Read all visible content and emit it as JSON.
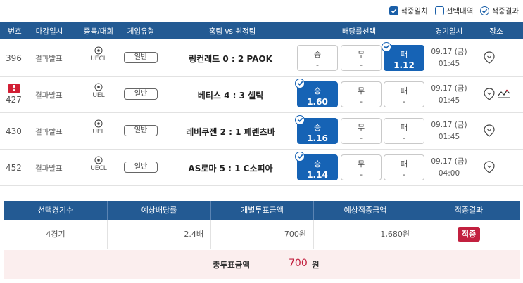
{
  "filters": [
    {
      "label": "적중일치",
      "checked": true
    },
    {
      "label": "선택내역",
      "checked": false
    },
    {
      "label": "적중결과",
      "checked": true
    }
  ],
  "columns": [
    "번호",
    "마감일시",
    "종목/대회",
    "게임유형",
    "홈팀 vs 원정팀",
    "배당률선택",
    "경기일시",
    "장소"
  ],
  "rows": [
    {
      "num": "396",
      "deadline": "결과발표",
      "league": "UECL",
      "type": "일반",
      "match": "링컨레드 0 : 2 PAOK",
      "odds": [
        {
          "label": "승",
          "value": "-"
        },
        {
          "label": "무",
          "value": "-"
        },
        {
          "label": "패",
          "value": "1.12"
        }
      ],
      "date": "09.17 (금)",
      "time": "01:45"
    },
    {
      "num": "427",
      "deadline": "결과발표",
      "league": "UEL",
      "type": "일반",
      "match": "베티스 4 : 3 셀틱",
      "odds": [
        {
          "label": "승",
          "value": "1.60"
        },
        {
          "label": "무",
          "value": "-"
        },
        {
          "label": "패",
          "value": "-"
        }
      ],
      "date": "09.17 (금)",
      "time": "01:45",
      "alert": "!"
    },
    {
      "num": "430",
      "deadline": "결과발표",
      "league": "UEL",
      "type": "일반",
      "match": "레버쿠젠 2 : 1 페렌츠바",
      "odds": [
        {
          "label": "승",
          "value": "1.16"
        },
        {
          "label": "무",
          "value": "-"
        },
        {
          "label": "패",
          "value": "-"
        }
      ],
      "date": "09.17 (금)",
      "time": "01:45"
    },
    {
      "num": "452",
      "deadline": "결과발표",
      "league": "UECL",
      "type": "일반",
      "match": "AS로마 5 : 1 C소피아",
      "odds": [
        {
          "label": "승",
          "value": "1.14"
        },
        {
          "label": "무",
          "value": "-"
        },
        {
          "label": "패",
          "value": "-"
        }
      ],
      "date": "09.17 (금)",
      "time": "04:00"
    }
  ],
  "summary": {
    "headers": [
      "선택경기수",
      "예상배당률",
      "개별투표금액",
      "예상적중금액",
      "적중결과"
    ],
    "games": "4경기",
    "odds": "2.4배",
    "bet": "700원",
    "payout": "1,680원",
    "result": "적중"
  },
  "total": {
    "label": "총투표금액",
    "amount": "700",
    "unit": "원"
  },
  "colors": {
    "header": "#235a93",
    "selected": "#1663b5",
    "accent": "#c2203f"
  }
}
